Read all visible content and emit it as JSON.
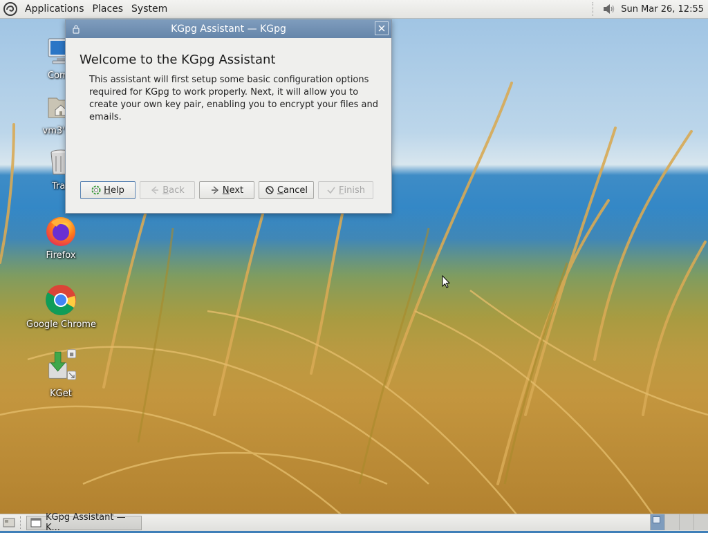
{
  "top_panel": {
    "menus": [
      "Applications",
      "Places",
      "System"
    ],
    "clock": "Sun Mar 26, 12:55"
  },
  "desktop_icons": [
    {
      "label": "Comp",
      "icon": "computer-icon"
    },
    {
      "label": "vm3's H",
      "icon": "home-folder-icon"
    },
    {
      "label": "Tras",
      "icon": "trash-icon"
    },
    {
      "label": "Firefox",
      "icon": "firefox-icon"
    },
    {
      "label": "Google Chrome",
      "icon": "chrome-icon"
    },
    {
      "label": "KGet",
      "icon": "kget-icon"
    }
  ],
  "dialog": {
    "title": "KGpg Assistant — KGpg",
    "heading": "Welcome to the KGpg Assistant",
    "description": "This assistant will first setup some basic configuration options required for KGpg to work properly. Next, it will allow you to create your own key pair, enabling you to encrypt your files and emails.",
    "buttons": {
      "help": {
        "mnemonic": "H",
        "rest": "elp",
        "enabled": true
      },
      "back": {
        "mnemonic": "B",
        "rest": "ack",
        "enabled": false
      },
      "next": {
        "mnemonic": "N",
        "rest": "ext",
        "enabled": true
      },
      "cancel": {
        "mnemonic": "C",
        "rest": "ancel",
        "enabled": true
      },
      "finish": {
        "mnemonic": "F",
        "rest": "inish",
        "enabled": false
      }
    }
  },
  "taskbar": {
    "task_label": "KGpg Assistant — K...",
    "workspaces": 4,
    "active_workspace": 1
  },
  "colors": {
    "titlebar": "#6f8fb3",
    "panel": "#e9e9e6",
    "dialog_bg": "#efefed"
  }
}
